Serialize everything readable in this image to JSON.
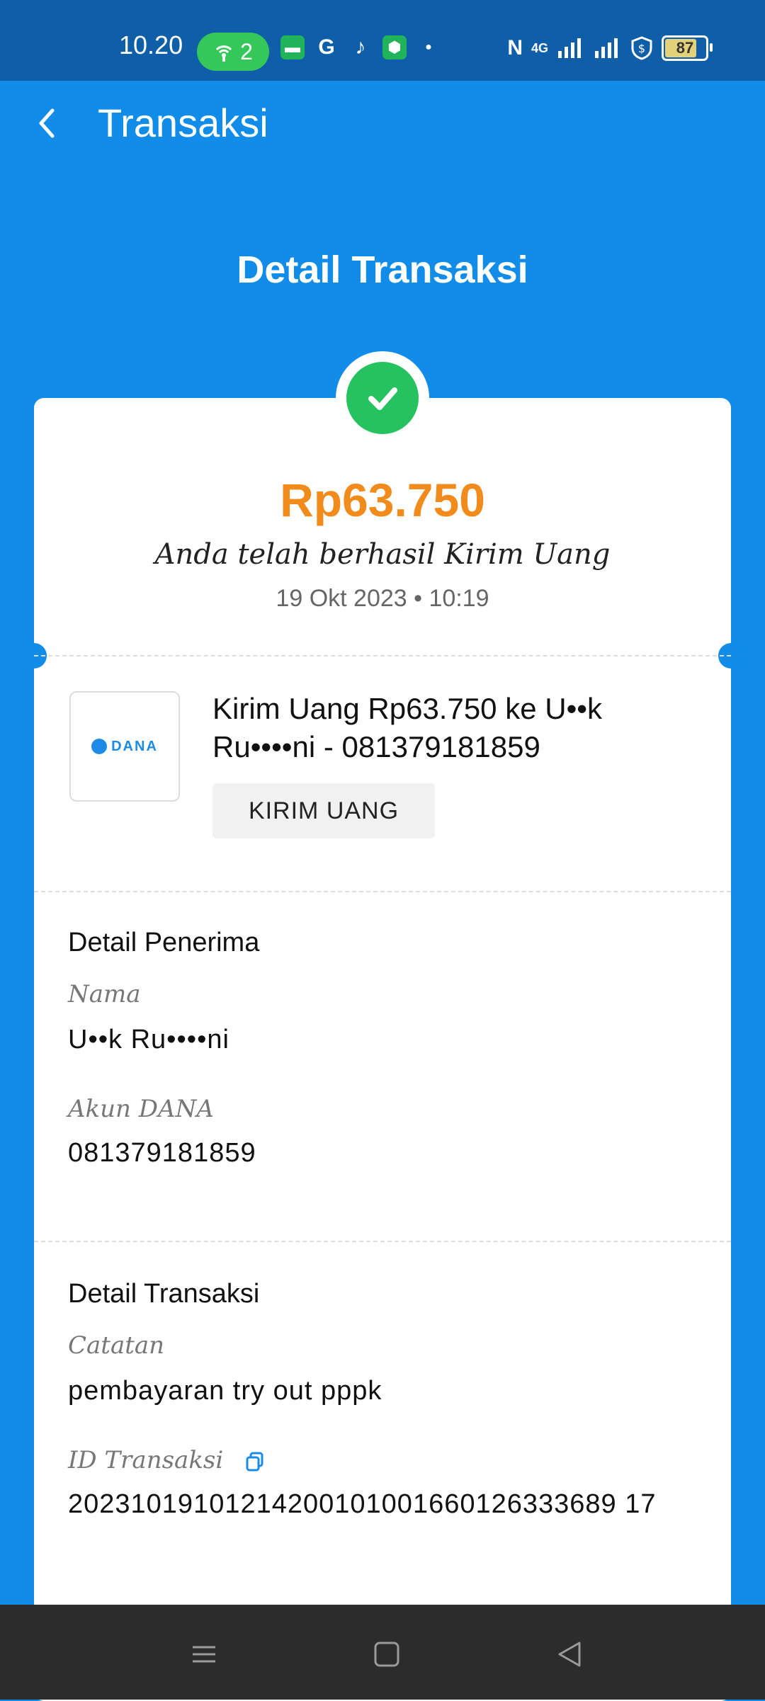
{
  "status_bar": {
    "time": "10.20",
    "hotspot_count": "2",
    "network": "4G",
    "battery": "87"
  },
  "app_bar": {
    "title": "Transaksi"
  },
  "page_heading": "Detail Transaksi",
  "summary": {
    "amount": "Rp63.750",
    "message": "Anda telah berhasil Kirim Uang",
    "datetime": "19 Okt 2023 • 10:19"
  },
  "transaction": {
    "logo_text": "DANA",
    "title": "Kirim Uang Rp63.750 ke U••k Ru••••ni - 081379181859",
    "category": "KIRIM UANG"
  },
  "recipient": {
    "section_title": "Detail Penerima",
    "name_label": "Nama",
    "name_value": "U••k Ru••••ni",
    "account_label": "Akun DANA",
    "account_value": "081379181859"
  },
  "details": {
    "section_title": "Detail Transaksi",
    "note_label": "Catatan",
    "note_value": "pembayaran try out pppk",
    "id_label": "ID Transaksi",
    "id_value": "20231019101214200101001660126333689 17"
  },
  "icons": {
    "back": "chevron-left-icon",
    "success": "check-icon",
    "copy": "copy-icon",
    "nav_menu": "menu-icon",
    "nav_home": "square-icon",
    "nav_back": "triangle-back-icon"
  }
}
